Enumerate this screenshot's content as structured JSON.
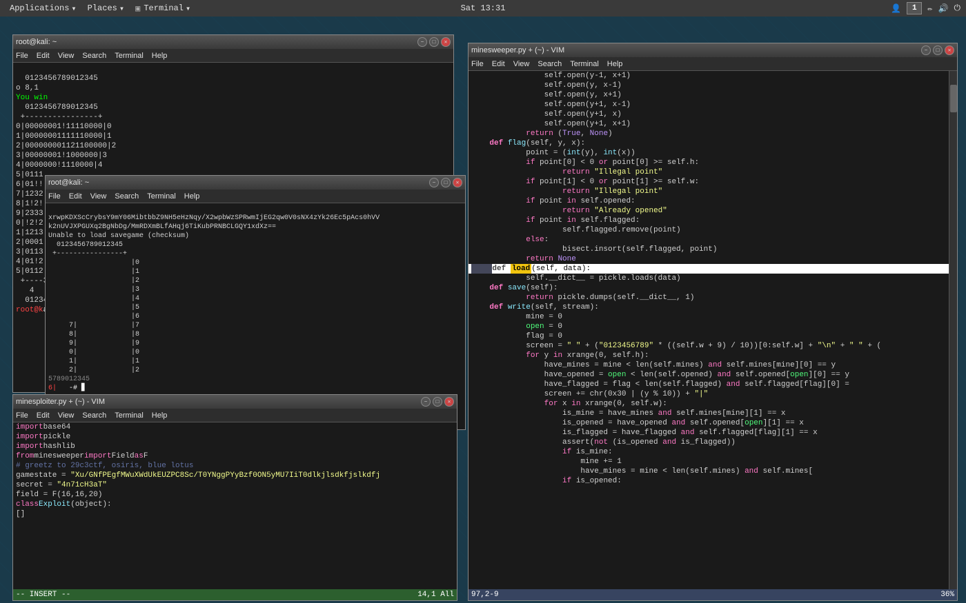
{
  "taskbar": {
    "apps_label": "Applications",
    "places_label": "Places",
    "terminal_label": "Terminal",
    "datetime": "Sat 13:31",
    "window_count": "1"
  },
  "window1": {
    "title": "root@kali: ~",
    "menu": [
      "File",
      "Edit",
      "View",
      "Search",
      "Terminal",
      "Help"
    ],
    "lines": [
      "  0123456789012345",
      "o 8,1",
      "You win",
      "  0123456789012345",
      " +----------------+",
      "0|00000001!11110000|0",
      "1|00000001111110000|1",
      "2|000000001121100000|2",
      "3|00000001!1000000|3",
      "4|0000000!1110000|4",
      "5|0111",
      "6|01!!",
      "7|1232",
      "8|1!2!",
      "9|2333",
      "0|!2!2",
      "1|1213",
      "2|0001",
      "3|0113",
      "4|01!2",
      "5|0112",
      " +----3",
      "  4",
      "  0123456789012345",
      "root@k"
    ]
  },
  "window2": {
    "title": "root@kali: ~",
    "menu": [
      "File",
      "Edit",
      "View",
      "Search",
      "Terminal",
      "Help"
    ],
    "lines": [
      "xrwpKDXScCrybsY9mY06MibtbbZ9NH5eHzNqy/X2wpbWzSPRwmIjEG2qw0V0sNX4zYk26Ec5pAcs0hVV",
      "k2nUVJXPGUXq2BgNbDg/MmRDXmBLfAHqj6TiKubPRNBCLGQY1xdXz==",
      "Unable to load savegame (checksum)",
      "  0123456789012345",
      " +----------------+",
      "                    |0",
      "                    |1",
      "                    |2",
      "                    |3",
      "                    |4",
      "                    |5",
      "                    |6",
      "     7|             |7",
      "     8|             |8",
      "     9|             |9",
      "     0|             |0",
      "     1|             |1",
      "     2|             |2",
      "5789012345",
      "6|    -# ▊"
    ]
  },
  "window3": {
    "title": "minesploiter.py + (~) - VIM",
    "menu": [
      "File",
      "Edit",
      "View",
      "Search",
      "Terminal",
      "Help"
    ],
    "lines": [
      "import base64",
      "import pickle",
      "import hashlib",
      "from minesweeper import Field as F",
      "",
      "# greetz to 29c3ctf, osiris, blue lotus",
      "",
      "gamestate = \"Xu/GNfPEgfMWuXWdUkEUZPC8Sc/T0YNggPYyBzf0ON5yMU7IiT0dlkjlsdkfjslkdfj",
      "",
      "secret = \"4n71cH3aT\"",
      "field = F(16,16,20)",
      "",
      "class Exploit(object):",
      "[]",
      "-- INSERT --"
    ],
    "statusbar": "14,1    All"
  },
  "window4": {
    "title": "minesweeper.py + (~) - VIM",
    "menu": [
      "File",
      "Edit",
      "View",
      "Search",
      "Terminal",
      "Help"
    ],
    "statusbar": "97,2-9    36%",
    "code_lines": [
      {
        "num": "",
        "code": "                self.open(y-1, x+1)"
      },
      {
        "num": "",
        "code": "                self.open(y, x-1)"
      },
      {
        "num": "",
        "code": "                self.open(y, x+1)"
      },
      {
        "num": "",
        "code": "                self.open(y+1, x-1)"
      },
      {
        "num": "",
        "code": "                self.open(y+1, x)"
      },
      {
        "num": "",
        "code": "                self.open(y+1, x+1)"
      },
      {
        "num": "",
        "code": "            return (True, None)"
      },
      {
        "num": "",
        "code": ""
      },
      {
        "num": "",
        "code": "    def flag(self, y, x):"
      },
      {
        "num": "",
        "code": "            point = (int(y), int(x))"
      },
      {
        "num": "",
        "code": "            if point[0] < 0 or point[0] >= self.h:"
      },
      {
        "num": "",
        "code": "                    return \"Illegal point\""
      },
      {
        "num": "",
        "code": "            if point[1] < 0 or point[1] >= self.w:"
      },
      {
        "num": "",
        "code": "                    return \"Illegal point\""
      },
      {
        "num": "",
        "code": "            if point in self.opened:"
      },
      {
        "num": "",
        "code": "                    return \"Already opened\""
      },
      {
        "num": "",
        "code": "            if point in self.flagged:"
      },
      {
        "num": "",
        "code": "                    self.flagged.remove(point)"
      },
      {
        "num": "",
        "code": "            else:"
      },
      {
        "num": "",
        "code": "                    bisect.insort(self.flagged, point)"
      },
      {
        "num": "",
        "code": "            return None"
      },
      {
        "num": "",
        "code": ""
      },
      {
        "num": "",
        "code": "    def load(self, data):    [HIGHLIGHTED]"
      },
      {
        "num": "",
        "code": "            self.__dict__ = pickle.loads(data)"
      },
      {
        "num": "",
        "code": ""
      },
      {
        "num": "",
        "code": "    def save(self):"
      },
      {
        "num": "",
        "code": "            return pickle.dumps(self.__dict__, 1)"
      },
      {
        "num": "",
        "code": ""
      },
      {
        "num": "",
        "code": "    def write(self, stream):"
      },
      {
        "num": "",
        "code": "            mine = 0"
      },
      {
        "num": "",
        "code": "            open = 0"
      },
      {
        "num": "",
        "code": "            flag = 0"
      },
      {
        "num": "",
        "code": "            screen = \" \" + (\"0123456789\" * ((self.w + 9) / 10))[0:self.w] + \"\\n\" + \" \" + ("
      },
      {
        "num": "",
        "code": "            for y in xrange(0, self.h):"
      },
      {
        "num": "",
        "code": "                have_mines = mine < len(self.mines) and self.mines[mine][0] == y"
      },
      {
        "num": "",
        "code": "                have_opened = open < len(self.opened) and self.opened[open][0] == y"
      },
      {
        "num": "",
        "code": "                have_flagged = flag < len(self.flagged) and self.flagged[flag][0] =="
      },
      {
        "num": "",
        "code": "                screen += chr(0x30 | (y % 10)) + \"|\""
      },
      {
        "num": "",
        "code": "                for x in xrange(0, self.w):"
      },
      {
        "num": "",
        "code": "                    is_mine = have_mines and self.mines[mine][1] == x"
      },
      {
        "num": "",
        "code": "                    is_opened = have_opened and self.opened[open][1] == x"
      },
      {
        "num": "",
        "code": "                    is_flagged = have_flagged and self.flagged[flag][1] == x"
      },
      {
        "num": "",
        "code": "                    assert(not (is_opened and is_flagged))"
      },
      {
        "num": "",
        "code": "                    if is_mine:"
      },
      {
        "num": "",
        "code": "                        mine += 1"
      },
      {
        "num": "",
        "code": "                        have_mines = mine < len(self.mines) and self.mines["
      },
      {
        "num": "",
        "code": "                    if is_opened:"
      }
    ]
  }
}
